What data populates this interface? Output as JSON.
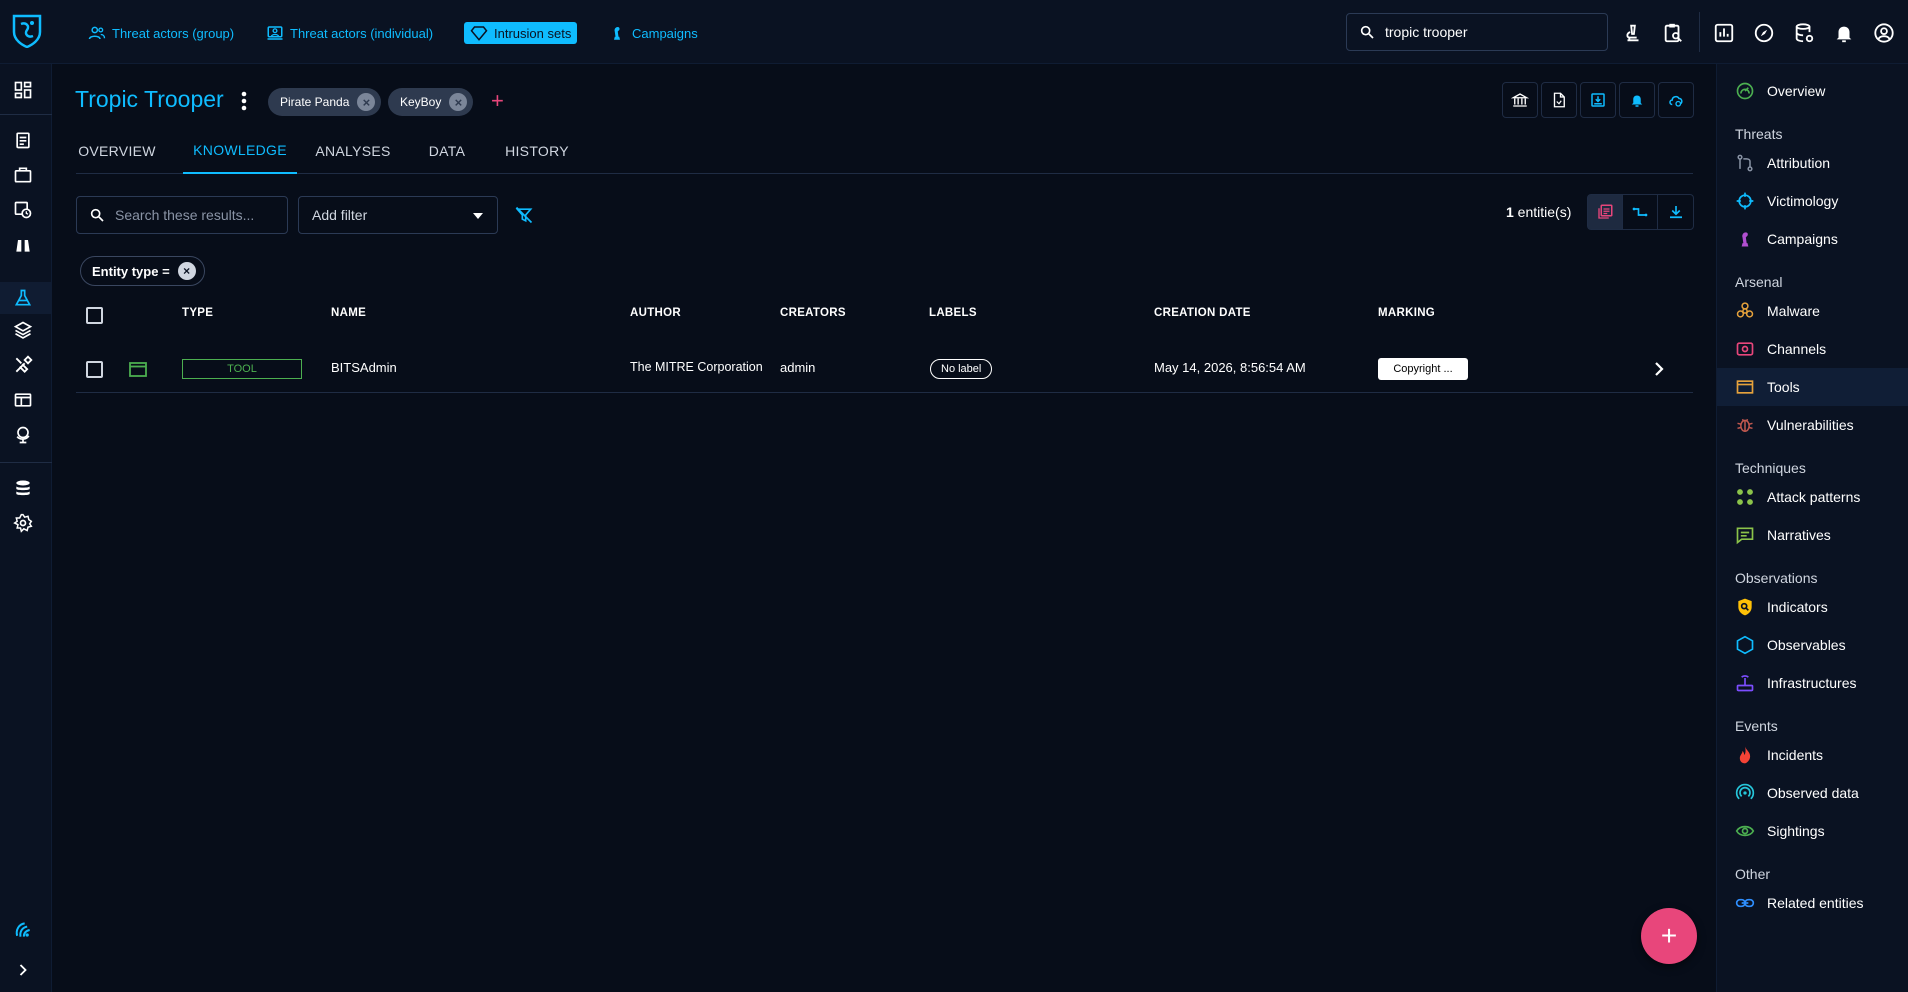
{
  "topnav": {
    "items": [
      {
        "label": "Threat actors (group)",
        "icon": "group-icon"
      },
      {
        "label": "Threat actors (individual)",
        "icon": "individual-icon"
      },
      {
        "label": "Intrusion sets",
        "icon": "diamond-icon",
        "active": true
      },
      {
        "label": "Campaigns",
        "icon": "chess-icon"
      }
    ],
    "search_value": "tropic trooper"
  },
  "entity": {
    "title": "Tropic Trooper",
    "aliases": [
      "Pirate Panda",
      "KeyBoy"
    ]
  },
  "tabs": [
    "OVERVIEW",
    "KNOWLEDGE",
    "ANALYSES",
    "DATA",
    "HISTORY"
  ],
  "active_tab": "KNOWLEDGE",
  "toolbar": {
    "search_placeholder": "Search these results...",
    "add_filter": "Add filter",
    "count_value": "1",
    "count_suffix": " entitie(s)"
  },
  "filter_chip": "Entity type =",
  "table": {
    "headers": [
      "TYPE",
      "NAME",
      "AUTHOR",
      "CREATORS",
      "LABELS",
      "CREATION DATE",
      "MARKING"
    ],
    "rows": [
      {
        "type": "TOOL",
        "name": "BITSAdmin",
        "author": "The MITRE Corporation",
        "creators": "admin",
        "labels": "No label",
        "creation_date": "May 14, 2026, 8:56:54 AM",
        "marking": "Copyright ..."
      }
    ]
  },
  "rightnav": {
    "overview": "Overview",
    "groups": [
      {
        "title": "Threats",
        "items": [
          "Attribution",
          "Victimology",
          "Campaigns"
        ]
      },
      {
        "title": "Arsenal",
        "items": [
          "Malware",
          "Channels",
          "Tools",
          "Vulnerabilities"
        ]
      },
      {
        "title": "Techniques",
        "items": [
          "Attack patterns",
          "Narratives"
        ]
      },
      {
        "title": "Observations",
        "items": [
          "Indicators",
          "Observables",
          "Infrastructures"
        ]
      },
      {
        "title": "Events",
        "items": [
          "Incidents",
          "Observed data",
          "Sightings"
        ]
      },
      {
        "title": "Other",
        "items": [
          "Related entities"
        ]
      }
    ],
    "active_item": "Tools"
  },
  "colors": {
    "accent": "#0fbcff",
    "pink": "#e8467b",
    "tool_green": "#4caf50",
    "background": "#070d19"
  }
}
